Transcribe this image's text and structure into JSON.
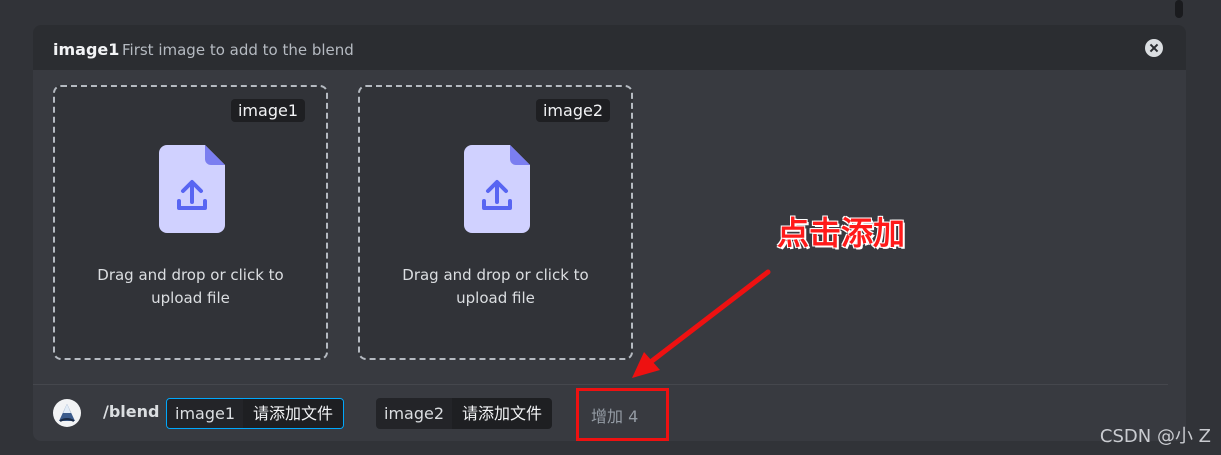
{
  "header": {
    "option_name": "image1",
    "option_description": "First image to add to the blend"
  },
  "uploads": [
    {
      "tag": "image1",
      "text": "Drag and drop or click to upload file"
    },
    {
      "tag": "image2",
      "text": "Drag and drop or click to upload file"
    }
  ],
  "command": {
    "name": "/blend",
    "options": [
      {
        "key": "image1",
        "value": "请添加文件"
      },
      {
        "key": "image2",
        "value": "请添加文件"
      }
    ],
    "more": "增加 4"
  },
  "annotation": {
    "text": "点击添加",
    "color": "#ff1a1a"
  },
  "watermark": "CSDN @小 Z",
  "icons": [
    "close-icon",
    "file-upload-icon",
    "bot-avatar",
    "arrow-annotation"
  ]
}
